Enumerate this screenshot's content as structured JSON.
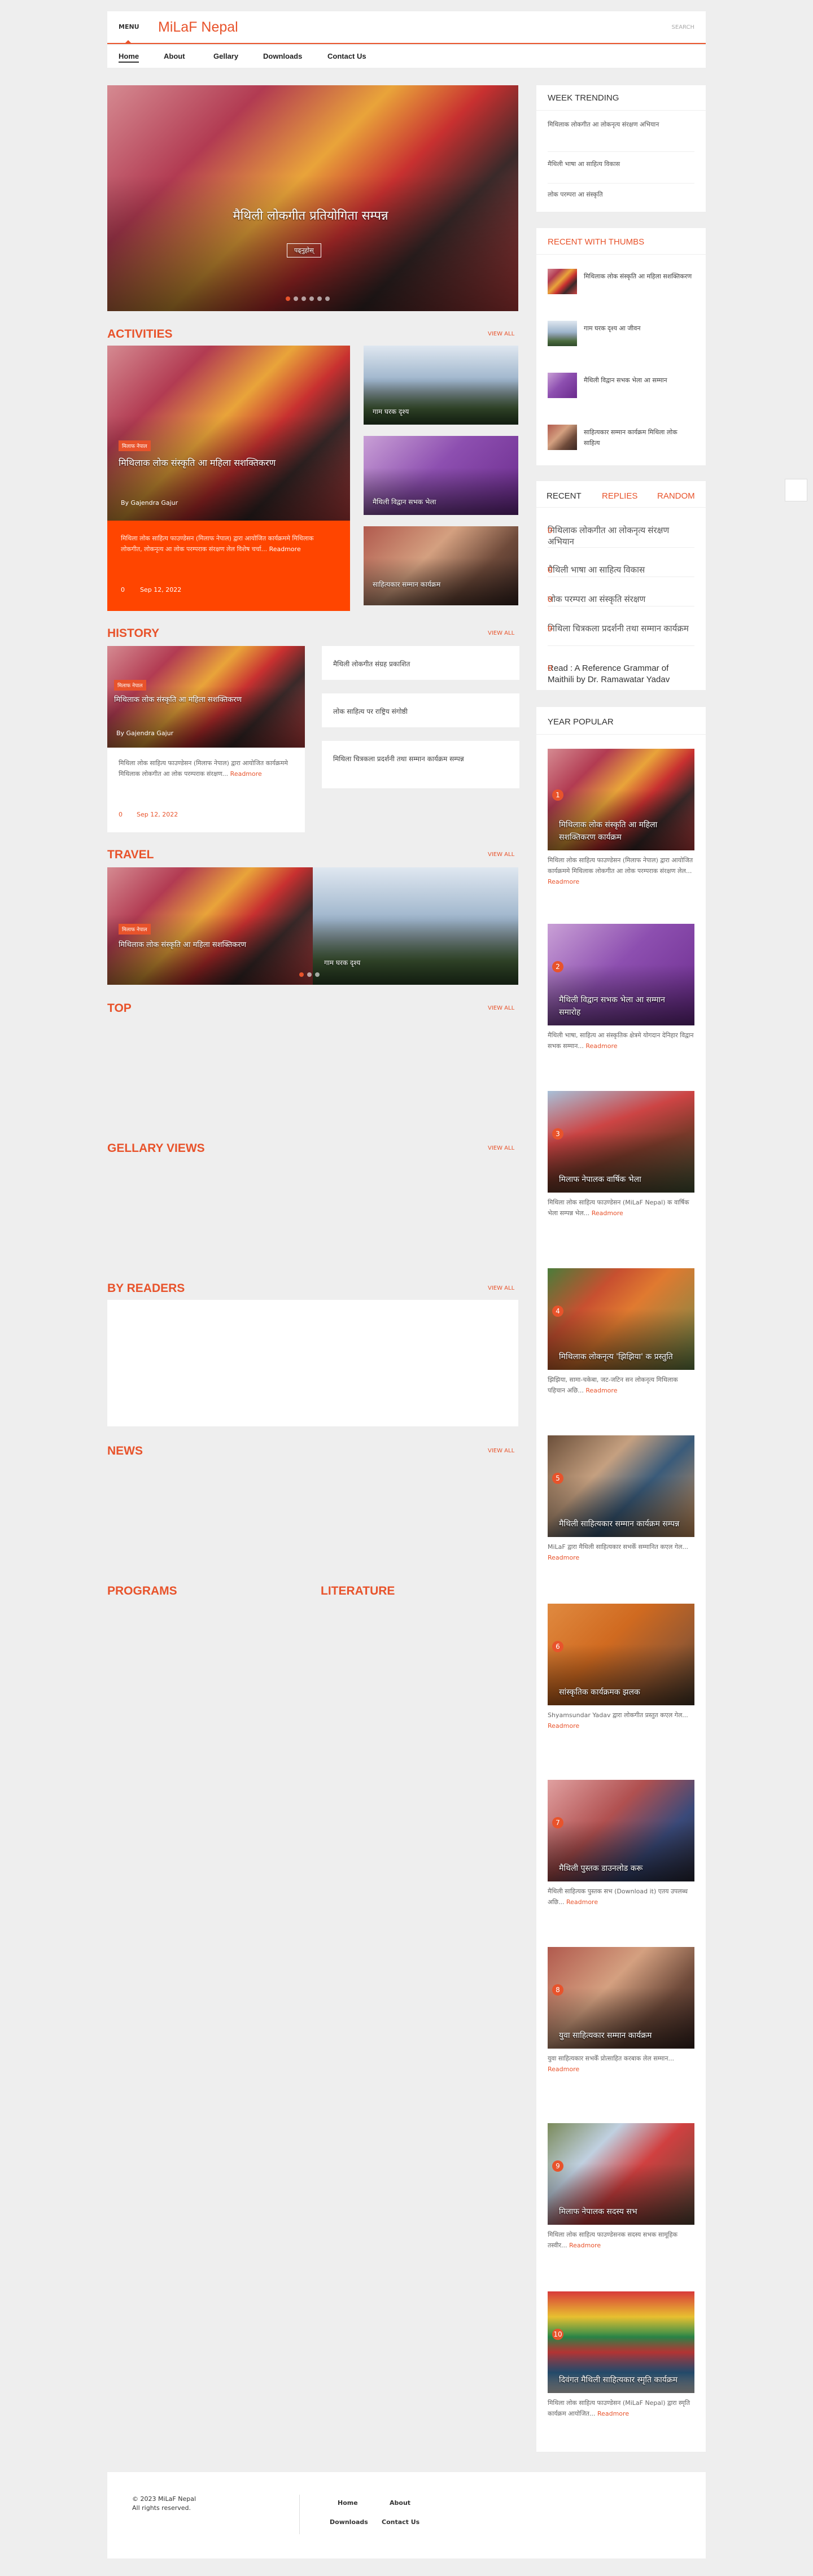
{
  "header": {
    "menu_label": "MENU",
    "logo": "MiLaF Nepal",
    "search_label": "SEARCH"
  },
  "nav": {
    "items": [
      "Home",
      "About",
      "Gellary",
      "Downloads",
      "Contact Us"
    ]
  },
  "colors": {
    "accent": "#e8532b",
    "activity_card": "#ff4500"
  },
  "slider": {
    "title": "मैथिली लोकगीत प्रतियोगिता सम्पन्न",
    "button": "पढ्नुहोस्",
    "slides": 6,
    "active": 0
  },
  "sections": {
    "activities": "ACTIVITIES",
    "history": "HISTORY",
    "travel": "TRAVEL",
    "top": "TOP",
    "gellary_views": "GELLARY VIEWS",
    "by_readers": "BY READERS",
    "news": "NEWS",
    "programs": "PROGRAMS",
    "literature": "LITERATURE",
    "view_all": "VIEW ALL"
  },
  "activities": {
    "main": {
      "badge": "मिलाफ नेपाल",
      "title": "मिथिलाक लोक संस्कृति आ महिला सशक्तिकरण",
      "author": "By Gajendra Gajur",
      "snippet": "मिथिला लोक साहित्य फाउण्डेसन (मिलाफ नेपाल) द्वारा आयोजित कार्यक्रममे मिथिलाक लोकगीत, लोकनृत्य आ लोक परम्पराक संरक्षण लेल विशेष चर्चा...",
      "readmore": "Readmore",
      "comments": "0",
      "date": "Sep 12, 2022"
    },
    "side": [
      {
        "title": "गाम घरक दृश्य"
      },
      {
        "title": "मैथिली विद्वान सभक भेला"
      },
      {
        "title": "साहित्यकार सम्मान कार्यक्रम"
      }
    ]
  },
  "history": {
    "main": {
      "badge": "मिलाफ नेपाल",
      "title": "मिथिलाक लोक संस्कृति आ महिला सशक्तिकरण",
      "author": "By Gajendra Gajur",
      "snippet": "मिथिला लोक साहित्य फाउण्डेसन (मिलाफ नेपाल) द्वारा आयोजित कार्यक्रममे मिथिलाक लोकगीत आ लोक परम्पराक संरक्षण...",
      "readmore": "Readmore",
      "comments": "0",
      "date": "Sep 12, 2022"
    },
    "list": [
      "मैथिली लोकगीत संग्रह प्रकाशित",
      "लोक साहित्य पर राष्ट्रिय संगोष्ठी",
      "मिथिला चित्रकला प्रदर्शनी तथा सम्मान कार्यक्रम सम्पन्न"
    ]
  },
  "travel": {
    "badge": "मिलाफ नेपाल",
    "title": "मिथिलाक लोक संस्कृति आ महिला सशक्तिकरण",
    "title2": "गाम घरक दृश्य",
    "slides": 3,
    "active": 0
  },
  "sidebar": {
    "week_trending": {
      "title": "WEEK TRENDING",
      "items": [
        "मिथिलाक लोकगीत आ लोकनृत्य संरक्षण अभियान",
        "मैथिली भाषा आ साहित्य विकास",
        "लोक परम्परा आ संस्कृति"
      ]
    },
    "recent_thumbs": {
      "title": "RECENT WITH THUMBS",
      "items": [
        "मिथिलाक लोक संस्कृति आ महिला सशक्तिकरण",
        "गाम घरक दृश्य आ जीवन",
        "मैथिली विद्वान सभक भेला आ सम्मान",
        "साहित्यकार सम्मान कार्यक्रम मिथिला लोक साहित्य"
      ]
    },
    "tabs": {
      "labels": [
        "RECENT",
        "REPLIES",
        "RANDOM"
      ],
      "items": [
        {
          "text": "मिथिलाक लोकगीत आ लोकनृत्य संरक्षण अभियान",
          "count": "0"
        },
        {
          "text": "मैथिली भाषा आ साहित्य विकास",
          "count": "0"
        },
        {
          "text": "लोक परम्परा आ संस्कृति संरक्षण",
          "count": "0"
        },
        {
          "text": "मिथिला चित्रकला प्रदर्शनी तथा सम्मान कार्यक्रम",
          "count": "0"
        },
        {
          "text": "Read : A Reference Grammar of Maithili by Dr. Ramawatar Yadav",
          "count": "0"
        }
      ]
    },
    "year_popular": {
      "title": "YEAR POPULAR",
      "readmore": "Readmore",
      "items": [
        {
          "num": "1",
          "title": "मिथिलाक लोक संस्कृति आ महिला सशक्तिकरण कार्यक्रम",
          "snippet": "मिथिला लोक साहित्य फाउण्डेसन (मिलाफ नेपाल) द्वारा आयोजित कार्यक्रममे मिथिलाक लोकगीत आ लोक परम्पराक संरक्षण लेल..."
        },
        {
          "num": "2",
          "title": "मैथिली विद्वान सभक भेला आ सम्मान समारोह",
          "snippet": "मैथिली भाषा, साहित्य आ संस्कृतिक क्षेत्रमे योगदान देनिहार विद्वान सभक सम्मान..."
        },
        {
          "num": "3",
          "title": "मिलाफ नेपालक वार्षिक भेला",
          "snippet": "मिथिला लोक साहित्य फाउण्डेसन (MiLaF Nepal) क वार्षिक भेला सम्पन्न भेल..."
        },
        {
          "num": "4",
          "title": "मिथिलाक लोकनृत्य 'झिझिया' क प्रस्तुति",
          "snippet": "झिझिया, सामा-चकेबा, जट-जटिन सन लोकनृत्य मिथिलाक पहिचान अछि..."
        },
        {
          "num": "5",
          "title": "मैथिली साहित्यकार सम्मान कार्यक्रम सम्पन्न",
          "snippet": "MiLaF द्वारा मैथिली साहित्यकार सभकेँ सम्मानित कएल गेल..."
        },
        {
          "num": "6",
          "title": "सांस्कृतिक कार्यक्रमक झलक",
          "snippet": "Shyamsundar Yadav द्वारा लोकगीत प्रस्तुत कएल गेल..."
        },
        {
          "num": "7",
          "title": "मैथिली पुस्तक डाउनलोड करू",
          "snippet": "मैथिली साहित्यक पुस्तक सभ (Download it) एतय उपलब्ध अछि..."
        },
        {
          "num": "8",
          "title": "युवा साहित्यकार सम्मान कार्यक्रम",
          "snippet": "युवा साहित्यकार सभकेँ प्रोत्साहित करबाक लेल सम्मान..."
        },
        {
          "num": "9",
          "title": "मिलाफ नेपालक सदस्य सभ",
          "snippet": "मिथिला लोक साहित्य फाउण्डेसनक सदस्य सभक सामूहिक तस्वीर..."
        },
        {
          "num": "10",
          "title": "दिवंगत मैथिली साहित्यकार स्मृति कार्यक्रम",
          "snippet": "मिथिला लोक साहित्य फाउण्डेसन (MiLaF Nepal) द्वारा स्मृति कार्यक्रम आयोजित..."
        }
      ]
    }
  },
  "footer": {
    "copyright": "© 2023 MiLaF Nepal",
    "rights": "All rights reserved.",
    "links": [
      "Home",
      "About",
      "Downloads",
      "Contact Us"
    ]
  }
}
